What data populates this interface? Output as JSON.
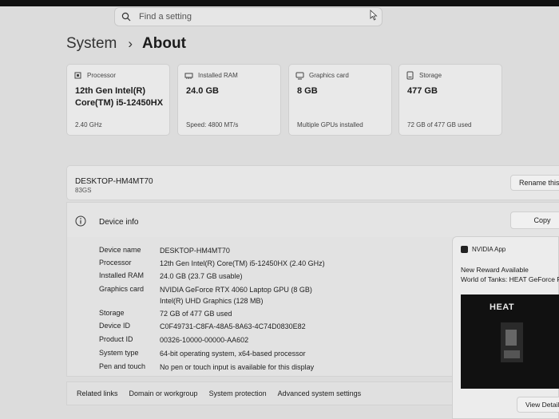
{
  "search": {
    "placeholder": "Find a setting"
  },
  "breadcrumb": {
    "parent": "System",
    "separator": "›",
    "current": "About"
  },
  "cards": [
    {
      "caption": "Processor",
      "value": "12th Gen Intel(R) Core(TM) i5-12450HX",
      "sub": "2.40 GHz",
      "icon": "processor-icon"
    },
    {
      "caption": "Installed RAM",
      "value": "24.0 GB",
      "sub": "Speed: 4800 MT/s",
      "icon": "ram-icon"
    },
    {
      "caption": "Graphics card",
      "value": "8 GB",
      "sub": "Multiple GPUs installed",
      "icon": "gpu-icon"
    },
    {
      "caption": "Storage",
      "value": "477 GB",
      "sub": "72 GB of 477 GB used",
      "icon": "storage-icon"
    }
  ],
  "pc": {
    "name": "DESKTOP-HM4MT70",
    "model": "83GS",
    "rename_label": "Rename this PC"
  },
  "device_info": {
    "title": "Device info",
    "copy_label": "Copy",
    "specs": [
      {
        "label": "Device name",
        "value": "DESKTOP-HM4MT70"
      },
      {
        "label": "Processor",
        "value": "12th Gen Intel(R) Core(TM) i5-12450HX (2.40 GHz)"
      },
      {
        "label": "Installed RAM",
        "value": "24.0 GB (23.7 GB usable)"
      },
      {
        "label": "Graphics card",
        "value": "NVIDIA GeForce RTX 4060 Laptop GPU (8 GB)",
        "value2": "Intel(R) UHD Graphics (128 MB)"
      },
      {
        "label": "Storage",
        "value": "72 GB of 477 GB used"
      },
      {
        "label": "Device ID",
        "value": "C0F49731-C8FA-48A5-8A63-4C74D0830E82"
      },
      {
        "label": "Product ID",
        "value": "00326-10000-00000-AA602"
      },
      {
        "label": "System type",
        "value": "64-bit operating system, x64-based processor"
      },
      {
        "label": "Pen and touch",
        "value": "No pen or touch input is available for this display"
      }
    ]
  },
  "related": {
    "label": "Related links",
    "links": [
      "Domain or workgroup",
      "System protection",
      "Advanced system settings"
    ]
  },
  "toast": {
    "app": "NVIDIA App",
    "line1": "New Reward Available",
    "line2": "World of Tanks: HEAT GeForce R",
    "image_text": "HEAT",
    "button": "View Details"
  }
}
